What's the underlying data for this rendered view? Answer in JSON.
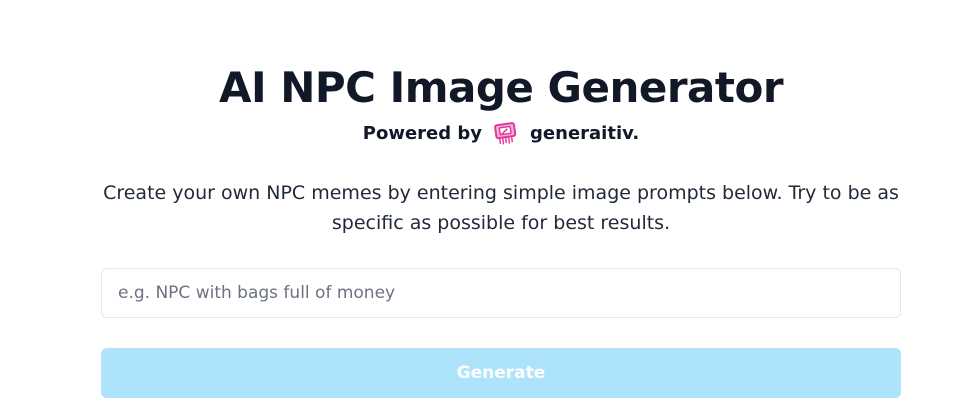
{
  "header": {
    "title": "AI NPC Image Generator",
    "powered_by_label": "Powered by",
    "brand_name": "generaitiv.",
    "brand_logo_icon": "generaitiv-logo-icon",
    "brand_color": "#e0399b"
  },
  "main": {
    "description": "Create your own NPC memes by entering simple image prompts below. Try to be as specific as possible for best results.",
    "prompt_input": {
      "value": "",
      "placeholder": "e.g. NPC with bags full of money"
    },
    "generate_button": {
      "label": "Generate",
      "color": "#ade3fb",
      "state": "disabled"
    }
  }
}
